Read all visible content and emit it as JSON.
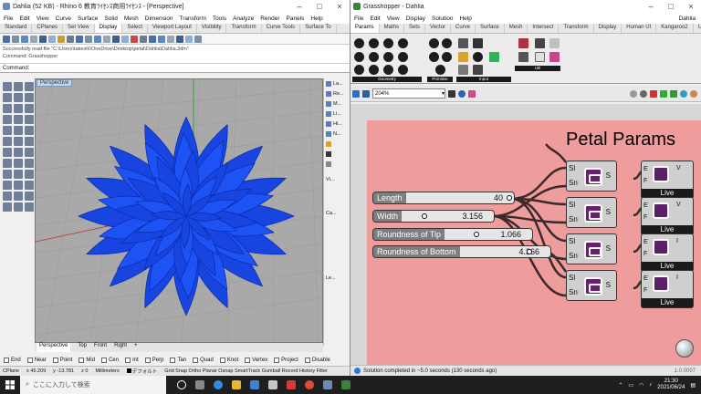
{
  "rhino": {
    "title": "Dahlia (52 KB) - Rhino 6 教育ﾗｲｾﾝｽ商用ﾗｲｾﾝｽ - [Perspective]",
    "menu": [
      "File",
      "Edit",
      "View",
      "Curve",
      "Surface",
      "Solid",
      "Mesh",
      "Dimension",
      "Transform",
      "Tools",
      "Analyze",
      "Render",
      "Panels",
      "Help"
    ],
    "tabs": [
      "Standard",
      "CPlanes",
      "Set View",
      "Display",
      "Select",
      "Viewport Layout",
      "Visibility",
      "Transform",
      "Curve Tools",
      "Surface To"
    ],
    "active_tab": "Display",
    "command_history": [
      "Successfully read file \"C:\\Users\\takeshi\\OneDrive\\Desktop\\petal\\Dahlia\\Dahlia.3dm\"",
      "Command: Grasshopper"
    ],
    "command_label": "Command:",
    "viewport_label": "Perspective",
    "panel_items": [
      "La...",
      "Re...",
      "M...",
      "Li...",
      "Hi...",
      "N...",
      "Vi...",
      "Ca...",
      "Le..."
    ],
    "view_tabs": [
      "Perspective",
      "Top",
      "Front",
      "Right"
    ],
    "active_view": "Perspective",
    "osnaps": [
      "End",
      "Near",
      "Point",
      "Mid",
      "Cen",
      "Int",
      "Perp",
      "Tan",
      "Quad",
      "Knot",
      "Vertex",
      "Project",
      "Disable"
    ],
    "status": {
      "cplane": "CPlane",
      "x": "x 45.209",
      "y": "y -13.781",
      "z": "z 0",
      "units": "Millimeters",
      "layer": "デフォルト",
      "toggles": "Grid Snap Ortho Planar Osnap SmartTrack Gumball Record History Filter"
    },
    "colors": {
      "flower": "#1a4cf0",
      "viewport": "#a9a9a9"
    }
  },
  "grasshopper": {
    "title": "Grasshopper - Dahlia",
    "menu": [
      "File",
      "Edit",
      "View",
      "Display",
      "Solution",
      "Help"
    ],
    "menu_right": "Dahlia",
    "tabs": [
      "Params",
      "Maths",
      "Sets",
      "Vector",
      "Curve",
      "Surface",
      "Mesh",
      "Intersect",
      "Transform",
      "Display",
      "Human UI",
      "Kangaroo2",
      "User"
    ],
    "active_tab": "Params",
    "ribbon_groups": [
      "Geometry",
      "Primitive",
      "Input",
      "Util"
    ],
    "zoom": "204%",
    "group_title": "Petal Params",
    "sliders": [
      {
        "name": "Length",
        "value": "40"
      },
      {
        "name": "Width",
        "value": "3.156"
      },
      {
        "name": "Roundness of Tip",
        "value": "1.066"
      },
      {
        "name": "Roundness of Bottom",
        "value": "4.366"
      }
    ],
    "slider_levels": [
      1.0,
      0.24,
      0.36,
      0.8
    ],
    "component": {
      "in1": "Sl",
      "in2": "Sn",
      "out": "S"
    },
    "live": {
      "e": "E",
      "f": "F",
      "v": "V",
      "i": "I",
      "label": "Live"
    },
    "status": "Solution completed in ~5.0 seconds (130 seconds ago)",
    "version": "1.0.0007",
    "colors": {
      "group": "#ee9c9c",
      "canvas": "#d7d7d7"
    }
  },
  "taskbar": {
    "search_placeholder": "ここに入力して検索",
    "time": "21:30",
    "date": "2021/06/24"
  }
}
